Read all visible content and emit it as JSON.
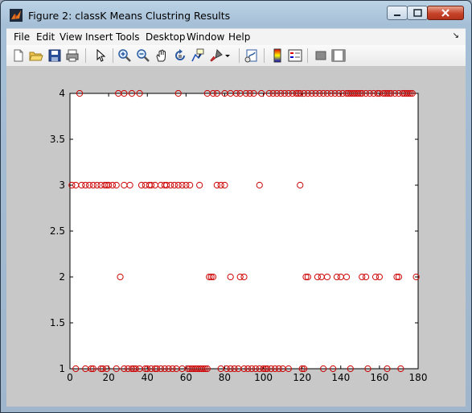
{
  "window": {
    "title": "Figure 2: classK Means Clustring Results"
  },
  "menubar": {
    "items": [
      "File",
      "Edit",
      "View",
      "Insert",
      "Tools",
      "Desktop",
      "Window",
      "Help"
    ]
  },
  "toolbar": {
    "icons": [
      "new-file-icon",
      "open-folder-icon",
      "save-icon",
      "print-icon",
      "pointer-icon",
      "zoom-in-icon",
      "zoom-out-icon",
      "pan-hand-icon",
      "rotate-3d-icon",
      "data-cursor-icon",
      "brush-icon",
      "link-plot-icon",
      "colorbar-icon",
      "legend-icon",
      "hide-plot-tools-icon",
      "show-plot-tools-icon"
    ]
  },
  "colors": {
    "marker": "#cc0000",
    "figure_bg": "#c8c8c8",
    "axes_bg": "#ffffff"
  },
  "chart_data": {
    "type": "scatter",
    "title": "",
    "xlabel": "",
    "ylabel": "",
    "xlim": [
      0,
      180
    ],
    "ylim": [
      1,
      4
    ],
    "xticks": [
      "0",
      "20",
      "40",
      "60",
      "80",
      "100",
      "120",
      "140",
      "160",
      "180"
    ],
    "yticks": [
      "1",
      "1.5",
      "2",
      "2.5",
      "3",
      "3.5",
      "4"
    ],
    "grid": false,
    "marker": "circle",
    "series": [
      {
        "y": 4,
        "x": [
          5,
          25,
          28,
          32,
          36,
          56,
          71,
          74,
          76,
          80,
          83,
          86,
          88,
          91,
          93,
          95,
          99,
          103,
          105,
          107,
          109,
          111,
          113,
          115,
          117,
          118,
          119,
          121,
          123,
          125,
          127,
          129,
          131,
          133,
          135,
          137,
          139,
          141,
          143,
          144,
          145,
          146,
          147,
          148,
          149,
          150,
          151,
          153,
          155,
          157,
          159,
          160,
          162,
          163,
          164,
          165,
          166,
          168,
          170,
          172,
          173,
          174,
          175,
          176,
          177
        ]
      },
      {
        "y": 3,
        "x": [
          1,
          3,
          6,
          8,
          10,
          12,
          14,
          16,
          18,
          19,
          20,
          22,
          24,
          28,
          31,
          37,
          39,
          41,
          42,
          44,
          47,
          49,
          50,
          52,
          54,
          56,
          58,
          60,
          62,
          67,
          76,
          78,
          80,
          98,
          119
        ]
      },
      {
        "y": 2,
        "x": [
          26,
          72,
          73,
          74,
          83,
          88,
          90,
          122,
          123,
          128,
          130,
          133,
          138,
          140,
          143,
          151,
          153,
          158,
          160,
          169,
          170,
          179
        ]
      },
      {
        "y": 1,
        "x": [
          3,
          8,
          11,
          12,
          16,
          17,
          19,
          24,
          28,
          30,
          32,
          33,
          34,
          36,
          39,
          40,
          42,
          44,
          45,
          47,
          49,
          51,
          53,
          55,
          58,
          61,
          62,
          63,
          64,
          65,
          66,
          67,
          68,
          69,
          70,
          71,
          78,
          81,
          83,
          85,
          87,
          90,
          92,
          94,
          96,
          98,
          100,
          101,
          102,
          104,
          106,
          108,
          110,
          113,
          120,
          121,
          131,
          136,
          145,
          154,
          164,
          171
        ]
      }
    ]
  }
}
